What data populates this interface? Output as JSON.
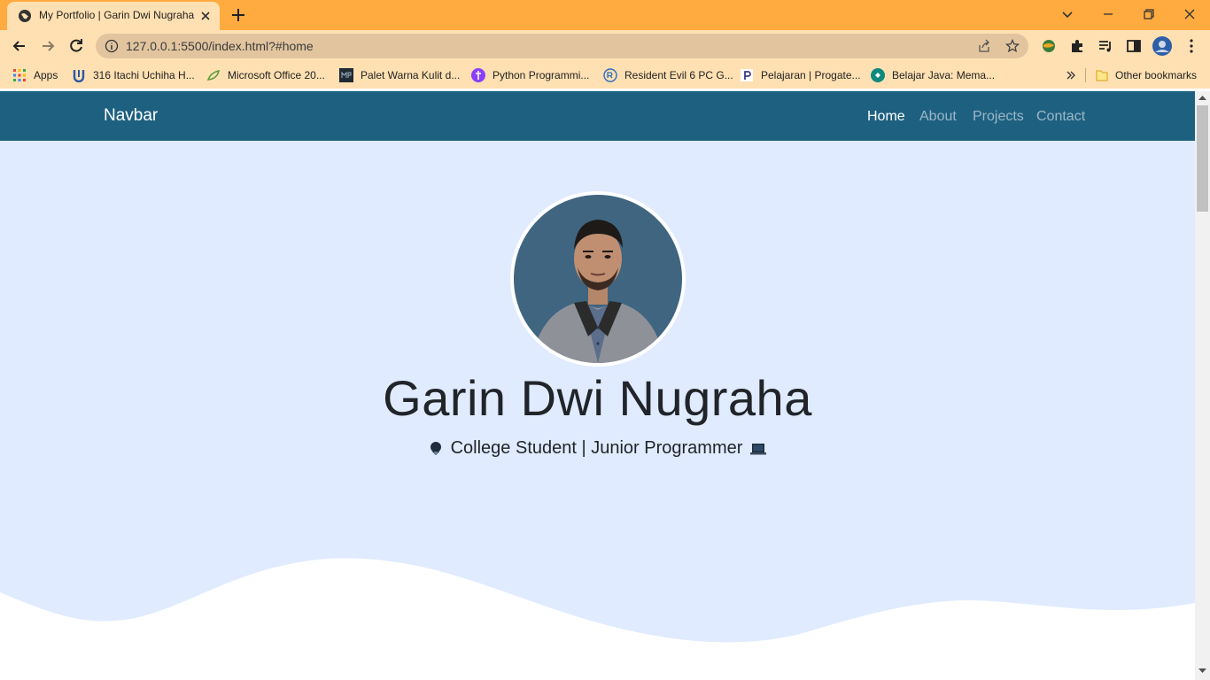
{
  "browser": {
    "tab_title": "My Portfolio | Garin Dwi Nugraha",
    "url": "127.0.0.1:5500/index.html?#home",
    "bookmarks": [
      {
        "label": "Apps",
        "icon": "apps-grid-icon"
      },
      {
        "label": "316 Itachi Uchiha H...",
        "icon": "u-logo-icon"
      },
      {
        "label": "Microsoft Office 20...",
        "icon": "leaf-icon"
      },
      {
        "label": "Palet Warna Kulit d...",
        "icon": "mp-logo-icon"
      },
      {
        "label": "Python Programmi...",
        "icon": "python-logo-icon"
      },
      {
        "label": "Resident Evil 6 PC G...",
        "icon": "re-logo-icon"
      },
      {
        "label": "Pelajaran | Progate...",
        "icon": "progate-logo-icon"
      },
      {
        "label": "Belajar Java: Mema...",
        "icon": "java-logo-icon"
      }
    ],
    "other_bookmarks": "Other bookmarks",
    "chrome_color": "#ffab40",
    "toolbar_color": "#ffe0b2"
  },
  "site": {
    "brand": "Navbar",
    "nav": [
      {
        "label": "Home",
        "active": true
      },
      {
        "label": "About",
        "active": false
      },
      {
        "label": "Projects",
        "active": false
      },
      {
        "label": "Contact",
        "active": false
      }
    ],
    "nav_color": "#1e6080",
    "hero_color": "#e0ebff"
  },
  "hero": {
    "name": "Garin Dwi Nugraha",
    "subtitle": "College Student | Junior Programmer",
    "subtitle_icons": [
      "graduate-icon",
      "laptop-icon"
    ]
  }
}
